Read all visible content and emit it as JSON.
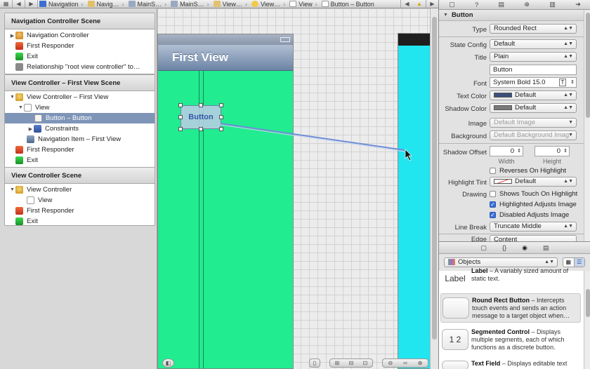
{
  "jumpbar": {
    "crumbs": [
      "Navigation",
      "Navig…",
      "MainS…",
      "MainS…",
      "View…",
      "View…",
      "View",
      "Button – Button"
    ]
  },
  "outline": {
    "scenes": [
      {
        "title": "Navigation Controller Scene",
        "rows": [
          "Navigation Controller",
          "First Responder",
          "Exit",
          "Relationship \"root view controller\" to…"
        ]
      },
      {
        "title": "View Controller – First View Scene",
        "rows": [
          "View Controller – First View",
          "View",
          "Button – Button",
          "Constraints",
          "Navigation Item – First View",
          "First Responder",
          "Exit"
        ]
      },
      {
        "title": "View Controller Scene",
        "rows": [
          "View Controller",
          "View",
          "First Responder",
          "Exit"
        ]
      }
    ]
  },
  "canvas": {
    "nav_title": "First View",
    "button_label": "Button"
  },
  "inspector": {
    "section": "Button",
    "type_label": "Type",
    "type_value": "Rounded Rect",
    "state_label": "State Config",
    "state_value": "Default",
    "title_label": "Title",
    "title_value": "Plain",
    "title_text": "Button",
    "font_label": "Font",
    "font_value": "System Bold 15.0",
    "text_color_label": "Text Color",
    "text_color_value": "Default",
    "shadow_color_label": "Shadow Color",
    "shadow_color_value": "Default",
    "image_label": "Image",
    "image_placeholder": "Default Image",
    "background_label": "Background",
    "background_placeholder": "Default Background Imag",
    "shadow_offset_label": "Shadow Offset",
    "shadow_w": "0",
    "shadow_h": "0",
    "width_label": "Width",
    "height_label": "Height",
    "reverses_label": "Reverses On Highlight",
    "highlight_tint_label": "Highlight Tint",
    "highlight_tint_value": "Default",
    "drawing_label": "Drawing",
    "shows_touch_label": "Shows Touch On Highlight",
    "highlighted_adjusts_label": "Highlighted Adjusts Image",
    "disabled_adjusts_label": "Disabled Adjusts Image",
    "line_break_label": "Line Break",
    "line_break_value": "Truncate Middle",
    "edge_label": "Edge",
    "edge_value": "Content"
  },
  "library": {
    "filter_value": "Objects",
    "items": [
      {
        "thumb": "Label",
        "title": "Label",
        "desc": "– A variably sized amount of static text."
      },
      {
        "thumb": "",
        "title": "Round Rect Button",
        "desc": "– Intercepts touch events and sends an action message to a target object when…"
      },
      {
        "thumb": "1 2",
        "title": "Segmented Control",
        "desc": "– Displays multiple segments, each of which functions as a discrete button."
      },
      {
        "thumb": "",
        "title": "Text Field",
        "desc": "– Displays editable text"
      }
    ]
  },
  "colors": {
    "scene_green": "#21ec8f",
    "scene_cyan": "#21e5ef",
    "selection": "#7f95b8",
    "navbar": "#6c84a6",
    "checkbox_on": "#3a6fd8"
  }
}
